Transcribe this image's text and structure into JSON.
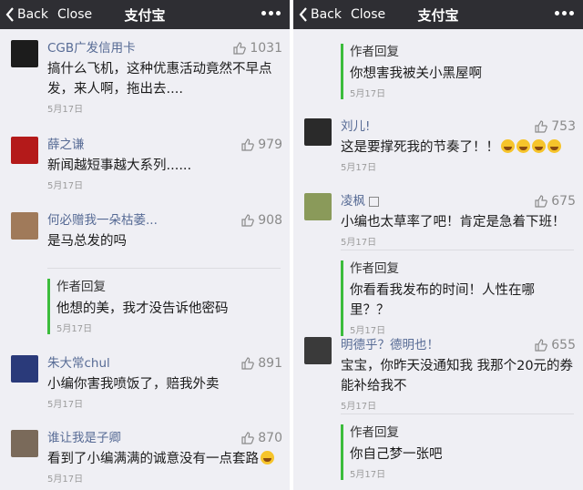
{
  "panes": [
    {
      "nav": {
        "back": "Back",
        "close": "Close",
        "title": "支付宝"
      },
      "comments": [
        {
          "nick": "CGB广发信用卡",
          "likes": "1031",
          "text": "搞什么飞机，这种优惠活动竟然不早点发，来人啊，拖出去....",
          "date": "5月17日",
          "avatar_color": "#1c1c1c"
        },
        {
          "nick": "薛之谦",
          "likes": "979",
          "text": "新闻越短事越大系列......",
          "date": "5月17日",
          "avatar_color": "#b41a1a"
        },
        {
          "nick": "何必赠我一朵枯萎...",
          "likes": "908",
          "text": "是马总发的吗",
          "date": "5月17日",
          "avatar_color": "#a07a5a"
        },
        {
          "nick": "朱大常chul",
          "likes": "891",
          "text": "小编你害我喷饭了，赔我外卖",
          "date": "5月17日",
          "avatar_color": "#2a3a7a"
        },
        {
          "nick": "谁让我是子卿",
          "likes": "870",
          "text": "看到了小编满满的诚意没有一点套路",
          "date": "5月17日",
          "avatar_color": "#7a6a5a"
        }
      ],
      "replies": [
        {
          "label": "作者回复",
          "text": "他想的美，我才没告诉他密码",
          "date": "5月17日"
        }
      ]
    },
    {
      "nav": {
        "back": "Back",
        "close": "Close",
        "title": "支付宝"
      },
      "comments": [
        {
          "nick": "刘儿!",
          "likes": "753",
          "text": "这是要撑死我的节奏了！！",
          "date": "5月17日",
          "avatar_color": "#2a2a2a"
        },
        {
          "nick": "凌枫",
          "likes": "675",
          "text": "小编也太草率了吧！肯定是急着下班！",
          "date": "5月17日",
          "avatar_color": "#8a9a5a"
        },
        {
          "nick": "明德乎？德明也！",
          "likes": "655",
          "text": "宝宝，你昨天没通知我 我那个20元的券能补给我不",
          "date": "5月17日",
          "avatar_color": "#3a3a3a"
        }
      ],
      "replies": [
        {
          "label": "作者回复",
          "text": "你想害我被关小黑屋啊",
          "date": "5月17日"
        },
        {
          "label": "作者回复",
          "text": "你看看我发布的时间！人性在哪里？？",
          "date": "5月17日"
        },
        {
          "label": "作者回复",
          "text": "你自己梦一张吧",
          "date": "5月17日"
        }
      ]
    }
  ],
  "colors": {
    "nav_bg": "#2e2e33",
    "nick": "#576b95",
    "reply_bar": "#3cbc3c"
  }
}
